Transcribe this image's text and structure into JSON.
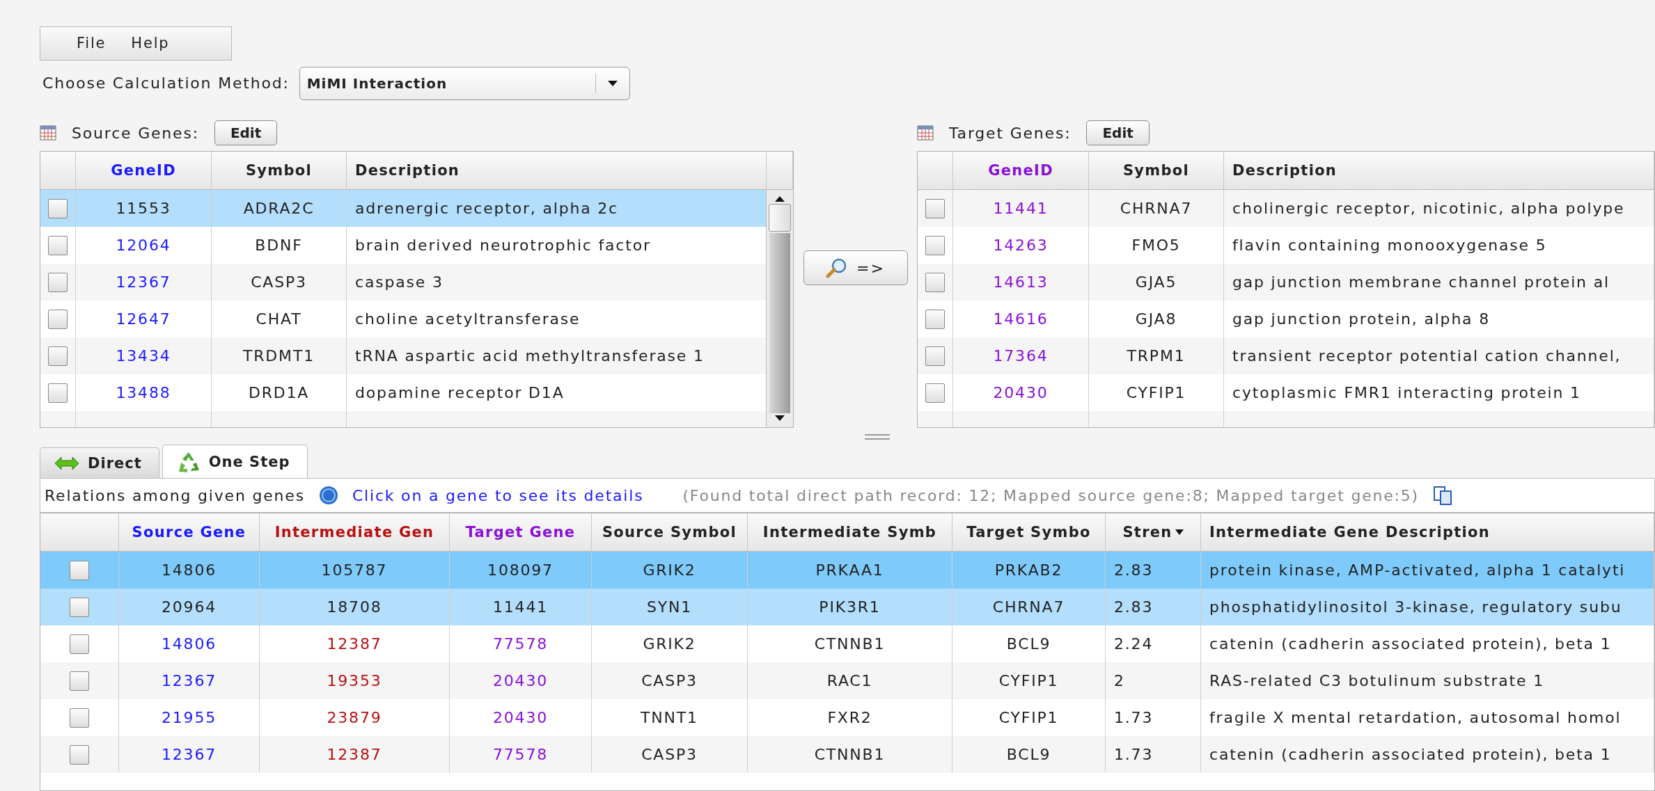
{
  "menu": [
    {
      "label": "File"
    },
    {
      "label": "Help"
    }
  ],
  "method": {
    "label": "Choose Calculation Method:",
    "value": "MiMI Interaction"
  },
  "source_genes": {
    "label": "Source Genes:",
    "button": "Edit",
    "columns": [
      {
        "label": "GeneID",
        "color": "#1a1aff"
      },
      {
        "label": "Symbol",
        "color": "#222222"
      },
      {
        "label": "Description",
        "color": "#222222"
      }
    ],
    "rows": [
      {
        "cells": [
          "11553",
          "ADRA2C",
          "adrenergic receptor, alpha 2c"
        ],
        "checked": false,
        "selected": true
      },
      {
        "cells": [
          "12064",
          "BDNF",
          "brain derived neurotrophic factor"
        ],
        "checked": false,
        "selected": false
      },
      {
        "cells": [
          "12367",
          "CASP3",
          "caspase 3"
        ],
        "checked": false,
        "selected": false
      },
      {
        "cells": [
          "12647",
          "CHAT",
          "choline acetyltransferase"
        ],
        "checked": false,
        "selected": false
      },
      {
        "cells": [
          "13434",
          "TRDMT1",
          "tRNA aspartic acid methyltransferase 1"
        ],
        "checked": false,
        "selected": false
      },
      {
        "cells": [
          "13488",
          "DRD1A",
          "dopamine receptor D1A"
        ],
        "checked": false,
        "selected": false
      }
    ]
  },
  "search_button": {
    "label": "=>"
  },
  "target_genes": {
    "label": "Target Genes:",
    "button": "Edit",
    "columns": [
      {
        "label": "GeneID",
        "color": "#8a10d8"
      },
      {
        "label": "Symbol",
        "color": "#222222"
      },
      {
        "label": "Description",
        "color": "#222222"
      }
    ],
    "rows": [
      {
        "cells": [
          "11441",
          "CHRNA7",
          "cholinergic receptor, nicotinic, alpha polype"
        ],
        "checked": false,
        "selected": false
      },
      {
        "cells": [
          "14263",
          "FMO5",
          "flavin containing monooxygenase 5"
        ],
        "checked": false,
        "selected": false
      },
      {
        "cells": [
          "14613",
          "GJA5",
          "gap junction membrane channel protein al"
        ],
        "checked": false,
        "selected": false
      },
      {
        "cells": [
          "14616",
          "GJA8",
          "gap junction protein, alpha 8"
        ],
        "checked": false,
        "selected": false
      },
      {
        "cells": [
          "17364",
          "TRPM1",
          "transient receptor potential cation channel,"
        ],
        "checked": false,
        "selected": false
      },
      {
        "cells": [
          "20430",
          "CYFIP1",
          "cytoplasmic FMR1 interacting protein 1"
        ],
        "checked": false,
        "selected": false
      }
    ]
  },
  "tabs": [
    {
      "label": "Direct",
      "kind": "arrows",
      "selected": false
    },
    {
      "label": "One Step",
      "kind": "recycle",
      "selected": true
    }
  ],
  "info": {
    "caption": "Relations among given genes",
    "link": "Click on a gene to see its details",
    "summary": "(Found total direct path record: 12; Mapped source gene:8; Mapped target gene:5)"
  },
  "results": {
    "columns": [
      {
        "label": "Source Gene",
        "color": "#1a1aff",
        "sorted": false
      },
      {
        "label": "Intermediate Gen",
        "color": "#b81010",
        "sorted": false
      },
      {
        "label": "Target Gene",
        "color": "#8a10d8",
        "sorted": false
      },
      {
        "label": "Source Symbol",
        "color": "#222222",
        "sorted": false
      },
      {
        "label": "Intermediate Symb",
        "color": "#222222",
        "sorted": false
      },
      {
        "label": "Target Symbo",
        "color": "#222222",
        "sorted": false
      },
      {
        "label": "Stren",
        "color": "#222222",
        "sorted": true
      },
      {
        "label": "Intermediate Gene Description",
        "color": "#222222",
        "sorted": false
      }
    ],
    "rows": [
      {
        "cells": [
          "14806",
          "105787",
          "108097",
          "GRIK2",
          "PRKAA1",
          "PRKAB2",
          "2.83",
          "protein kinase, AMP-activated, alpha 1 catalyti"
        ],
        "checked": false,
        "selected": true,
        "hovered": false
      },
      {
        "cells": [
          "20964",
          "18708",
          "11441",
          "SYN1",
          "PIK3R1",
          "CHRNA7",
          "2.83",
          "phosphatidylinositol 3-kinase, regulatory subu"
        ],
        "checked": false,
        "selected": false,
        "hovered": true
      },
      {
        "cells": [
          "14806",
          "12387",
          "77578",
          "GRIK2",
          "CTNNB1",
          "BCL9",
          "2.24",
          "catenin (cadherin associated protein), beta 1"
        ],
        "checked": false,
        "selected": false,
        "hovered": false
      },
      {
        "cells": [
          "12367",
          "19353",
          "20430",
          "CASP3",
          "RAC1",
          "CYFIP1",
          "2",
          "RAS-related C3 botulinum substrate 1"
        ],
        "checked": false,
        "selected": false,
        "hovered": false
      },
      {
        "cells": [
          "21955",
          "23879",
          "20430",
          "TNNT1",
          "FXR2",
          "CYFIP1",
          "1.73",
          "fragile X mental retardation, autosomal homol"
        ],
        "checked": false,
        "selected": false,
        "hovered": false
      },
      {
        "cells": [
          "12367",
          "12387",
          "77578",
          "CASP3",
          "CTNNB1",
          "BCL9",
          "1.73",
          "catenin (cadherin associated protein), beta 1"
        ],
        "checked": false,
        "selected": false,
        "hovered": false
      }
    ]
  }
}
